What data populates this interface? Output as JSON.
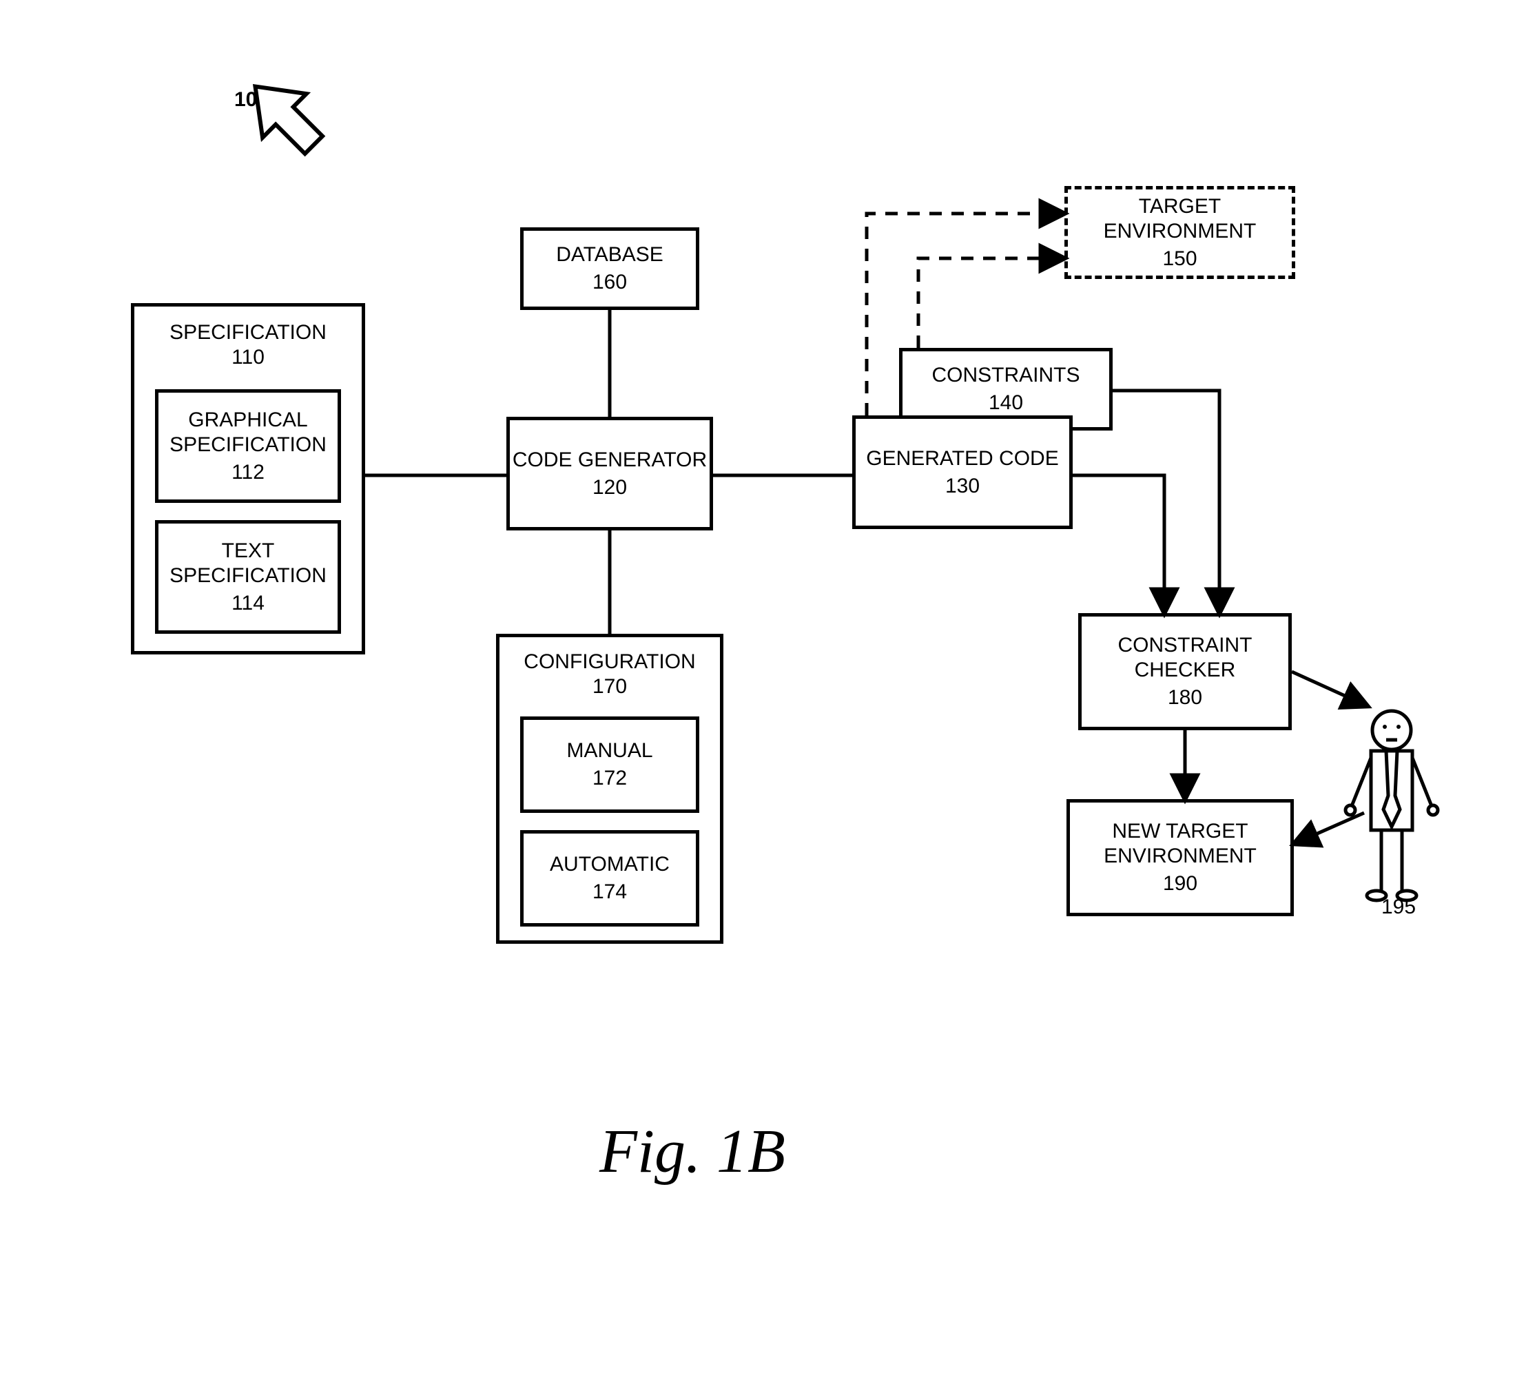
{
  "pointer_label": "105",
  "specification": {
    "title": "SPECIFICATION",
    "num": "110",
    "graphical": {
      "title": "GRAPHICAL SPECIFICATION",
      "num": "112"
    },
    "text": {
      "title": "TEXT SPECIFICATION",
      "num": "114"
    }
  },
  "database": {
    "title": "DATABASE",
    "num": "160"
  },
  "code_generator": {
    "title": "CODE GENERATOR",
    "num": "120"
  },
  "configuration": {
    "title": "CONFIGURATION",
    "num": "170",
    "manual": {
      "title": "MANUAL",
      "num": "172"
    },
    "automatic": {
      "title": "AUTOMATIC",
      "num": "174"
    }
  },
  "generated_code": {
    "title": "GENERATED CODE",
    "num": "130"
  },
  "constraints": {
    "title": "CONSTRAINTS",
    "num": "140"
  },
  "target_env": {
    "title": "TARGET ENVIRONMENT",
    "num": "150"
  },
  "constraint_checker": {
    "title": "CONSTRAINT CHECKER",
    "num": "180"
  },
  "new_target_env": {
    "title": "NEW TARGET ENVIRONMENT",
    "num": "190"
  },
  "person_label": "195",
  "figure_caption": "Fig. 1B"
}
